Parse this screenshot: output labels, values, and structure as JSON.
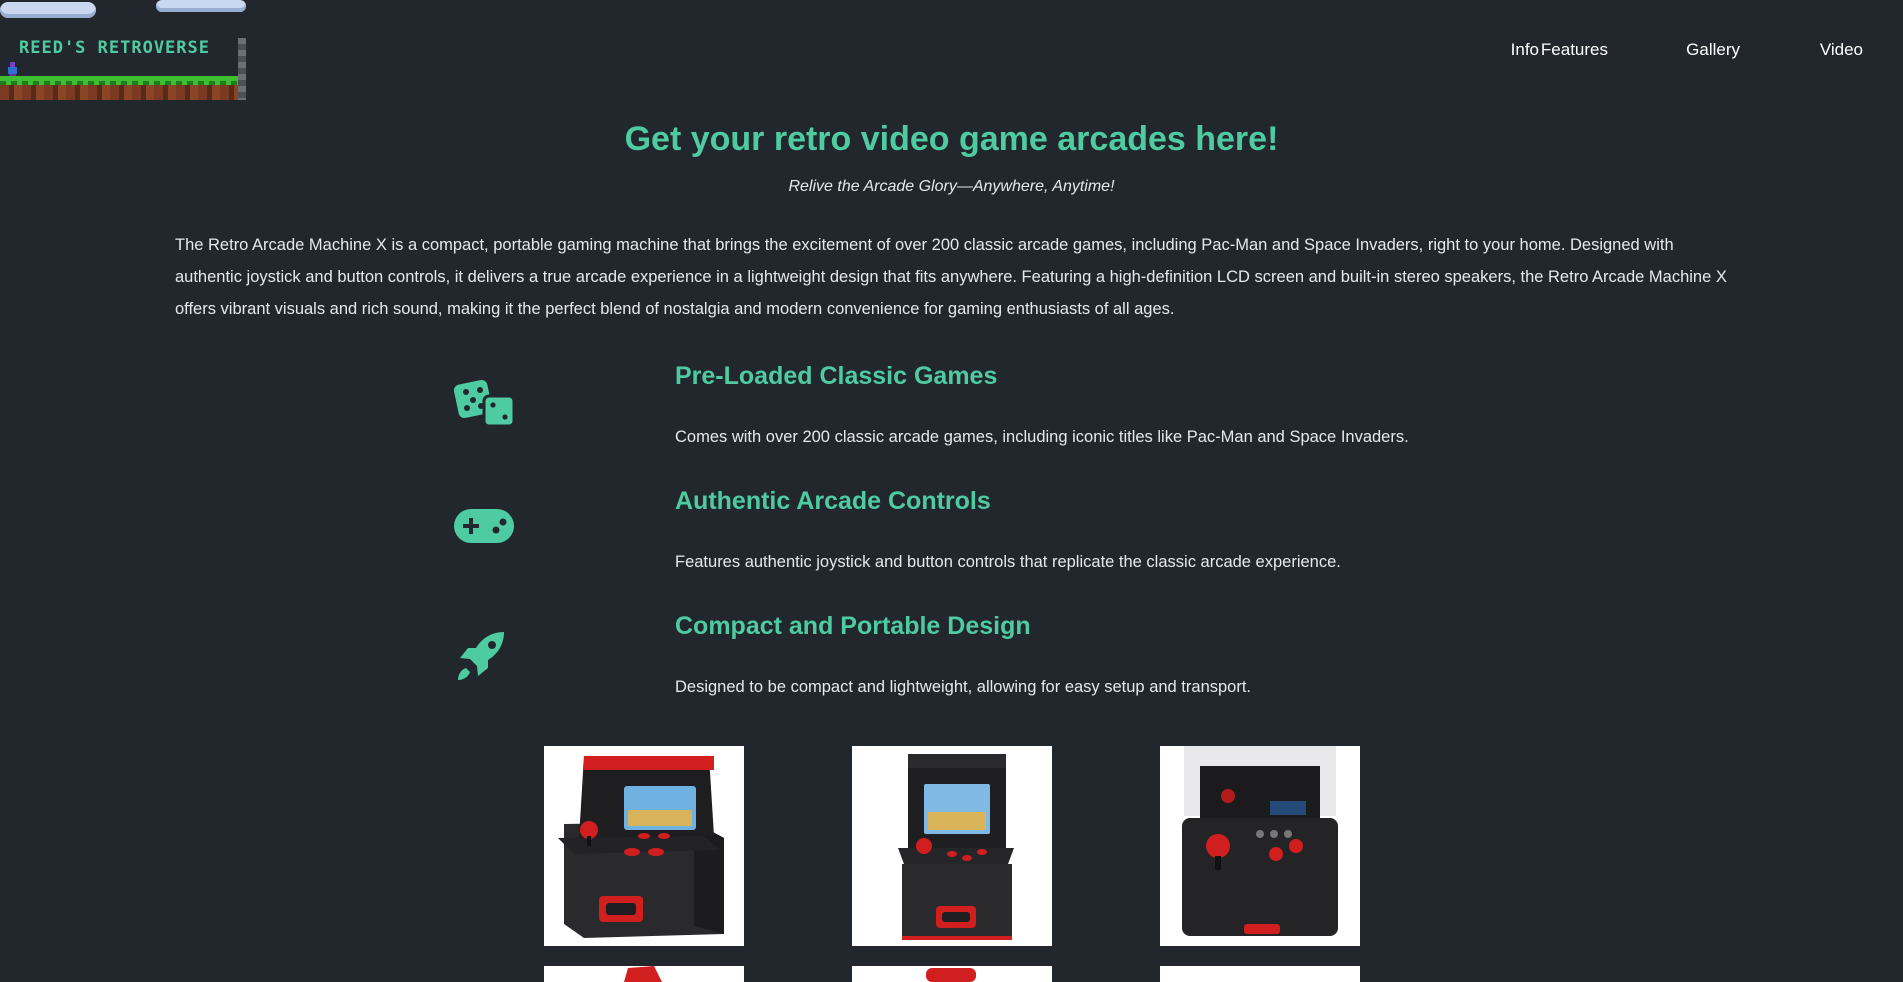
{
  "brand": {
    "logo_text": "REED'S RETROVERSE"
  },
  "nav": {
    "items": [
      "Info",
      "Features",
      "Gallery",
      "Video"
    ]
  },
  "hero": {
    "title": "Get your retro video game arcades here!",
    "tagline": "Relive the Arcade Glory—Anywhere, Anytime!",
    "intro": "The Retro Arcade Machine X is a compact, portable gaming machine that brings the excitement of over 200 classic arcade games, including Pac-Man and Space Invaders, right to your home. Designed with authentic joystick and button controls, it delivers a true arcade experience in a lightweight design that fits anywhere. Featuring a high-definition LCD screen and built-in stereo speakers, the Retro Arcade Machine X offers vibrant visuals and rich sound, making it the perfect blend of nostalgia and modern convenience for gaming enthusiasts of all ages."
  },
  "features": [
    {
      "icon": "dice-icon",
      "title": "Pre-Loaded Classic Games",
      "description": "Comes with over 200 classic arcade games, including iconic titles like Pac-Man and Space Invaders."
    },
    {
      "icon": "gamepad-icon",
      "title": "Authentic Arcade Controls",
      "description": "Features authentic joystick and button controls that replicate the classic arcade experience."
    },
    {
      "icon": "rocket-icon",
      "title": "Compact and Portable Design",
      "description": "Designed to be compact and lightweight, allowing for easy setup and transport."
    }
  ],
  "gallery": {
    "images": [
      {
        "name": "arcade-machine-front-angle"
      },
      {
        "name": "arcade-machine-front"
      },
      {
        "name": "arcade-machine-top-view"
      }
    ]
  },
  "colors": {
    "accent": "#4ecba0",
    "background": "#22272e",
    "arcade_red": "#d11f1f"
  }
}
